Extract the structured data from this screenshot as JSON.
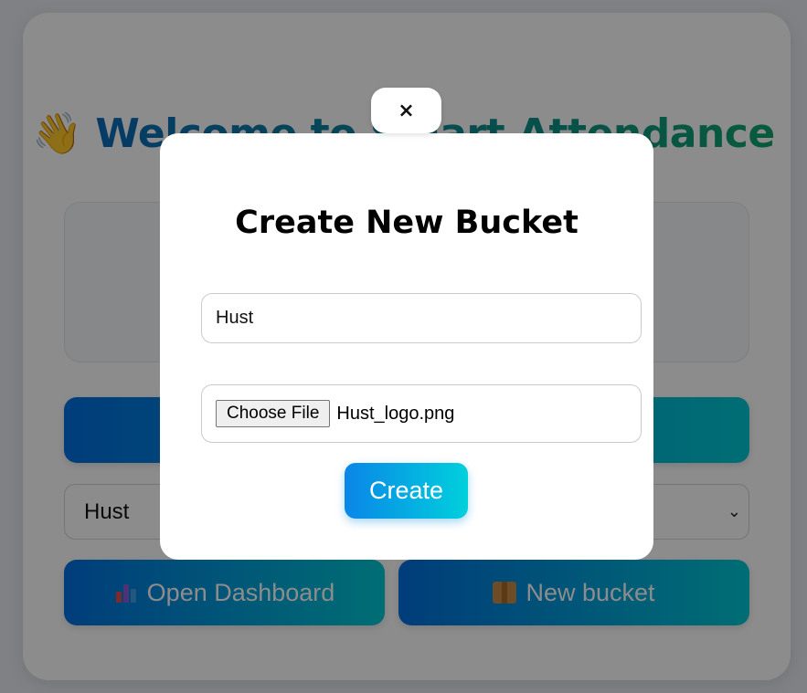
{
  "page": {
    "title_emoji": "👋",
    "title": "Welcome to Smart Attendance",
    "capture_button_label": "",
    "bucket_select": {
      "selected": "Hust"
    },
    "dashboard_button": {
      "label": "Open Dashboard",
      "icon": "bar-chart-icon"
    },
    "new_bucket_button": {
      "label": "New bucket",
      "icon": "package-icon"
    }
  },
  "modal": {
    "close_label": "×",
    "title": "Create New Bucket",
    "name_input": {
      "value": "Hust"
    },
    "file_input": {
      "button_label": "Choose File",
      "file_name": "Hust_logo.png"
    },
    "create_label": "Create"
  },
  "colors": {
    "gradient_start": "#0070e0",
    "gradient_end": "#00c8d4",
    "title_start": "#0b63c4",
    "title_end": "#0fa86b",
    "overlay": "rgba(0,0,0,0.45)"
  }
}
